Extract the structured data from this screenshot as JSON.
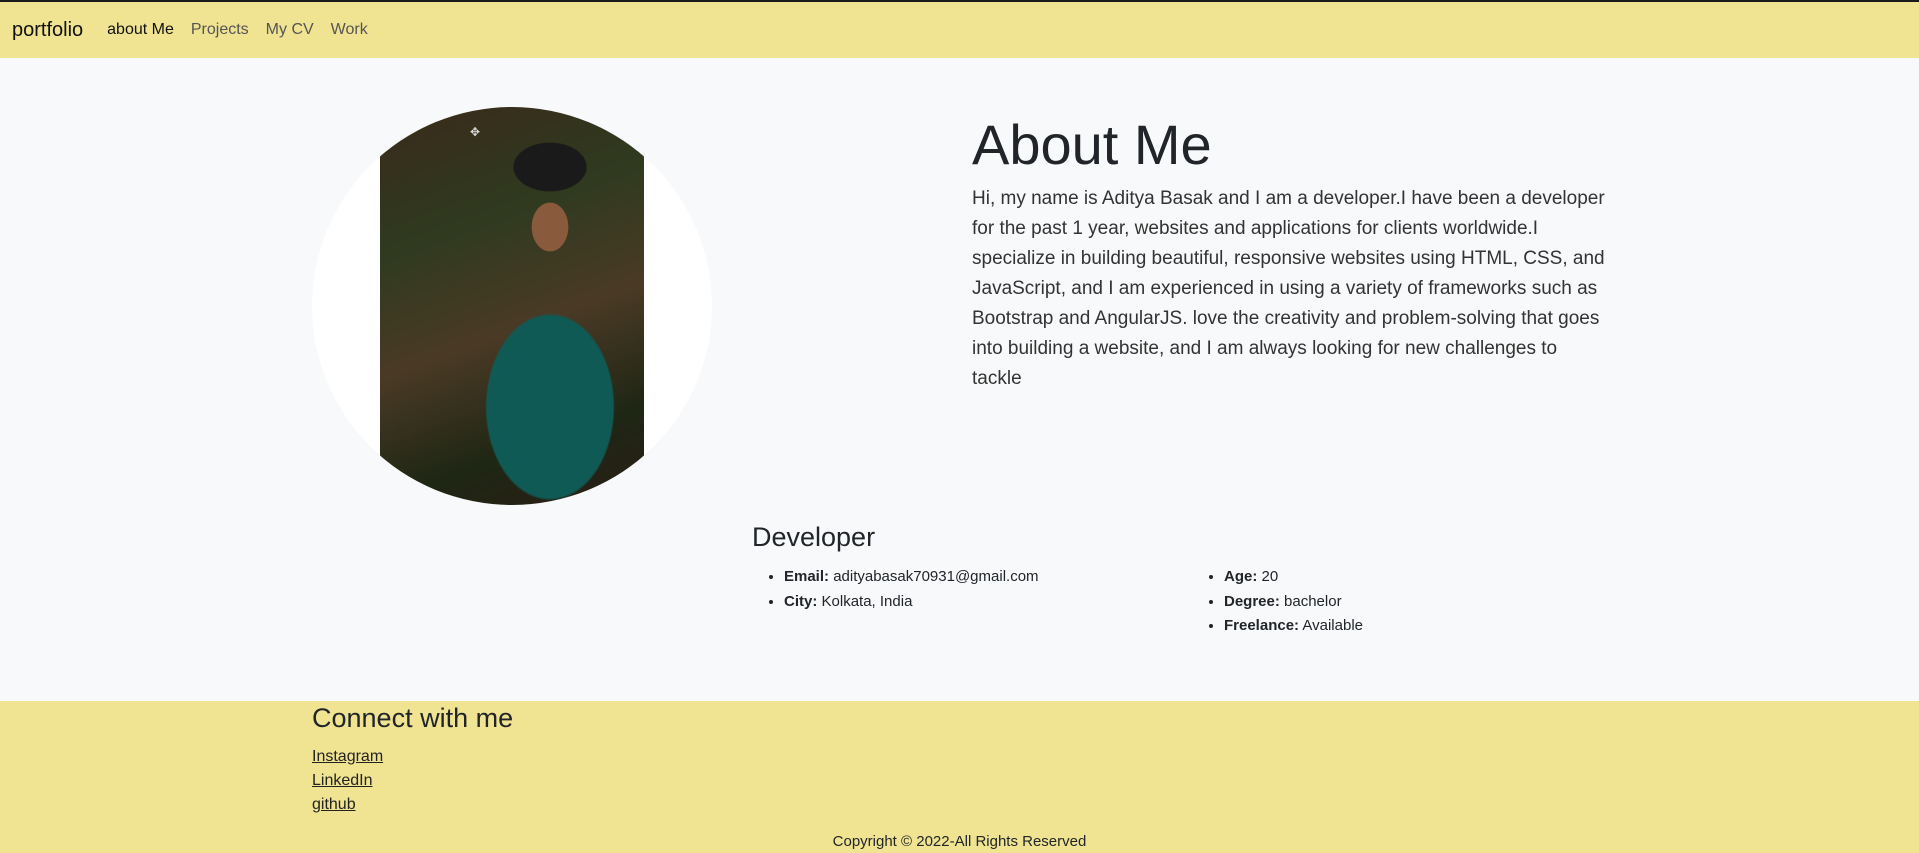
{
  "navbar": {
    "brand": "portfolio",
    "links": [
      {
        "label": "about Me",
        "active": true
      },
      {
        "label": "Projects",
        "active": false
      },
      {
        "label": "My CV",
        "active": false
      },
      {
        "label": "Work",
        "active": false
      }
    ]
  },
  "about": {
    "title": "About Me",
    "text": "Hi, my name is Aditya Basak and I am a developer.I have been a developer for the past 1 year, websites and applications for clients worldwide.I specialize in building beautiful, responsive websites using HTML, CSS, and JavaScript, and I am experienced in using a variety of frameworks such as Bootstrap and AngularJS. love the creativity and problem-solving that goes into building a website, and I am always looking for new challenges to tackle"
  },
  "developer": {
    "title": "Developer",
    "left": [
      {
        "label": "Email:",
        "value": "adityabasak70931@gmail.com"
      },
      {
        "label": "City:",
        "value": "Kolkata, India"
      }
    ],
    "right": [
      {
        "label": "Age:",
        "value": "20"
      },
      {
        "label": "Degree:",
        "value": "bachelor"
      },
      {
        "label": "Freelance:",
        "value": "Available"
      }
    ]
  },
  "footer": {
    "title": "Connect with me",
    "links": [
      "Instagram",
      "LinkedIn",
      "github"
    ],
    "copyright": "Copyright © 2022-All Rights Reserved"
  },
  "colors": {
    "bar": "#f0e391",
    "page": "#f8f9fa"
  }
}
